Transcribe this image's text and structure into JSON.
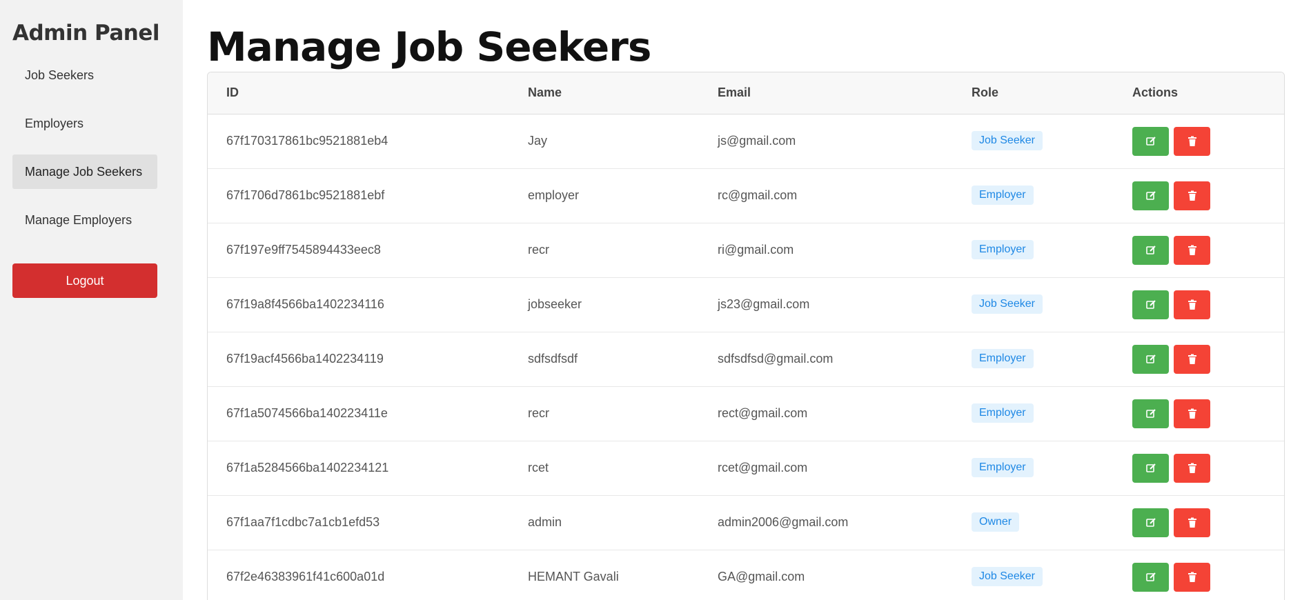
{
  "sidebar": {
    "title": "Admin Panel",
    "items": [
      {
        "label": "Job Seekers"
      },
      {
        "label": "Employers"
      },
      {
        "label": "Manage Job Seekers"
      },
      {
        "label": "Manage Employers"
      }
    ],
    "logout_label": "Logout"
  },
  "main": {
    "title": "Manage Job Seekers",
    "table": {
      "headers": [
        "ID",
        "Name",
        "Email",
        "Role",
        "Actions"
      ],
      "rows": [
        {
          "id": "67f170317861bc9521881eb4",
          "name": "Jay",
          "email": "js@gmail.com",
          "role": "Job Seeker"
        },
        {
          "id": "67f1706d7861bc9521881ebf",
          "name": "employer",
          "email": "rc@gmail.com",
          "role": "Employer"
        },
        {
          "id": "67f197e9ff7545894433eec8",
          "name": "recr",
          "email": "ri@gmail.com",
          "role": "Employer"
        },
        {
          "id": "67f19a8f4566ba1402234116",
          "name": "jobseeker",
          "email": "js23@gmail.com",
          "role": "Job Seeker"
        },
        {
          "id": "67f19acf4566ba1402234119",
          "name": "sdfsdfsdf",
          "email": "sdfsdfsd@gmail.com",
          "role": "Employer"
        },
        {
          "id": "67f1a5074566ba140223411e",
          "name": "recr",
          "email": "rect@gmail.com",
          "role": "Employer"
        },
        {
          "id": "67f1a5284566ba1402234121",
          "name": "rcet",
          "email": "rcet@gmail.com",
          "role": "Employer"
        },
        {
          "id": "67f1aa7f1cdbc7a1cb1efd53",
          "name": "admin",
          "email": "admin2006@gmail.com",
          "role": "Owner"
        },
        {
          "id": "67f2e46383961f41c600a01d",
          "name": "HEMANT Gavali",
          "email": "GA@gmail.com",
          "role": "Job Seeker"
        }
      ]
    }
  },
  "colors": {
    "sidebar_bg": "#f2f2f2",
    "active_item_bg": "#e0e0e0",
    "logout_red": "#d32f2f",
    "edit_green": "#4caf50",
    "delete_red": "#f44336",
    "badge_bg": "#e3f2fd",
    "badge_text": "#1e88e5"
  },
  "icons": {
    "edit": "edit-icon",
    "delete": "trash-icon"
  }
}
